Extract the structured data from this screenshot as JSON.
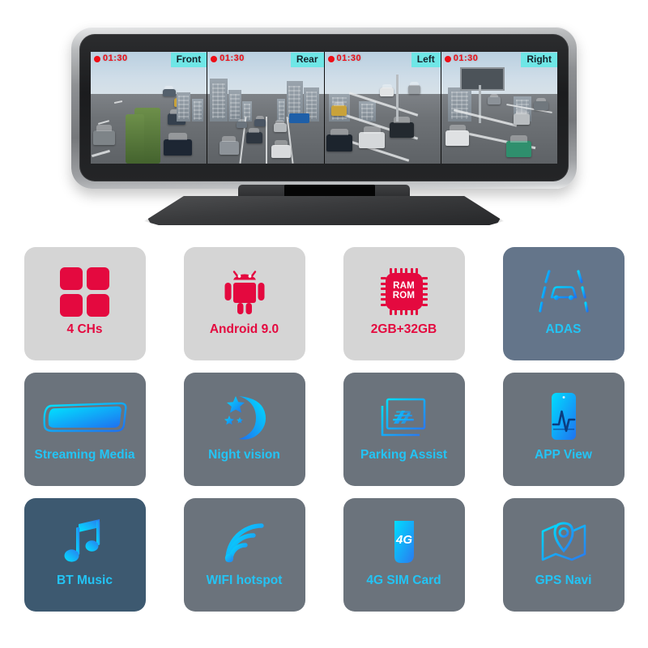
{
  "device": {
    "name": "4-channel mirror dashcam monitor",
    "screen": {
      "cameras": [
        {
          "label": "Front",
          "timestamp": "01:30",
          "rec_indicator": "record-dot"
        },
        {
          "label": "Rear",
          "timestamp": "01:30",
          "rec_indicator": "record-dot"
        },
        {
          "label": "Left",
          "timestamp": "01:30",
          "rec_indicator": "record-dot"
        },
        {
          "label": "Right",
          "timestamp": "01:30",
          "rec_indicator": "record-dot"
        }
      ],
      "label_bg_color": "#6fe6e6",
      "timestamp_color": "#ee0d16"
    }
  },
  "colors": {
    "accent_red": "#e4093f",
    "accent_cyan": "#23c4f5",
    "card_light": "#d5d5d5",
    "card_slate": "#6b737c",
    "card_steel": "#64758a",
    "card_navy": "#3d5970"
  },
  "features": [
    {
      "label": "4 CHs",
      "icon": "four-squares-icon",
      "theme": "theme-light"
    },
    {
      "label": "Android 9.0",
      "icon": "android-robot-icon",
      "theme": "theme-light"
    },
    {
      "label": "2GB+32GB",
      "icon": "memory-chip-icon",
      "theme": "theme-light",
      "chip_line1": "RAM",
      "chip_line2": "ROM"
    },
    {
      "label": "ADAS",
      "icon": "adas-lane-car-icon",
      "theme": "theme-steel"
    },
    {
      "label": "Streaming Media",
      "icon": "mirror-screen-icon",
      "theme": "theme-slate"
    },
    {
      "label": "Night vision",
      "icon": "moon-stars-icon",
      "theme": "theme-slate"
    },
    {
      "label": "Parking Assist",
      "icon": "parking-guideline-icon",
      "theme": "theme-slate"
    },
    {
      "label": "APP View",
      "icon": "phone-waveform-icon",
      "theme": "theme-slate"
    },
    {
      "label": "BT Music",
      "icon": "music-note-icon",
      "theme": "theme-navy"
    },
    {
      "label": "WIFI hotspot",
      "icon": "wifi-signal-icon",
      "theme": "theme-slate"
    },
    {
      "label": "4G SIM Card",
      "icon": "sim-card-4g-icon",
      "theme": "theme-slate",
      "sim_text": "4G"
    },
    {
      "label": "GPS Navi",
      "icon": "map-pin-icon",
      "theme": "theme-slate"
    }
  ]
}
